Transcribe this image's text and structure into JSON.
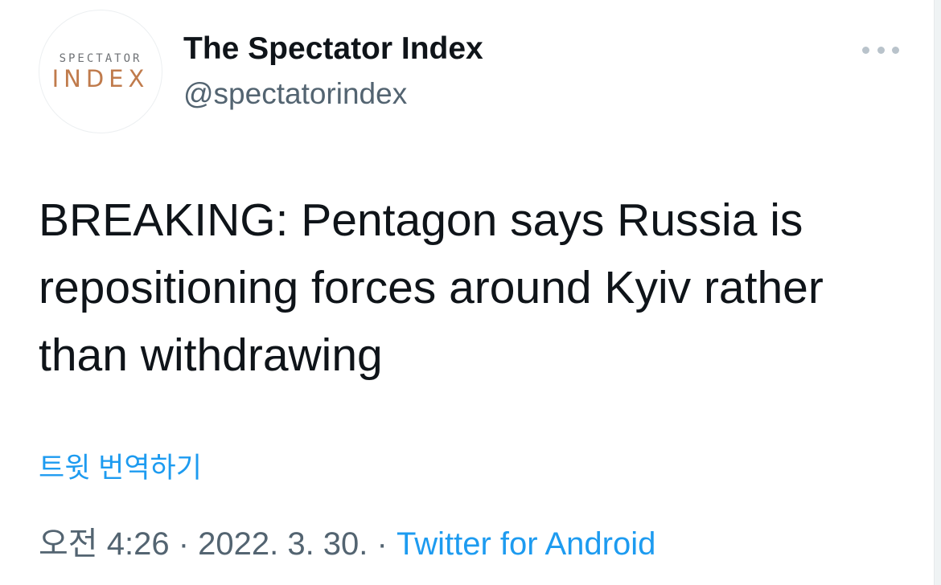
{
  "author": {
    "avatar": {
      "line1": "SPECTATOR",
      "line2": "INDEX"
    },
    "name": "The Spectator Index",
    "handle": "@spectatorindex"
  },
  "tweet": {
    "text": "BREAKING: Pentagon says Russia is repositioning forces around Kyiv rather than withdrawing",
    "translate_label": "트윗 번역하기"
  },
  "meta": {
    "time": "오전 4:26",
    "separator": " · ",
    "date": "2022. 3. 30.",
    "source": "Twitter for Android"
  },
  "icons": {
    "more": "more-horizontal-icon"
  },
  "colors": {
    "link": "#1d9bf0",
    "secondary_text": "#536471",
    "primary_text": "#0f1419",
    "avatar_accent": "#c07b4c"
  }
}
